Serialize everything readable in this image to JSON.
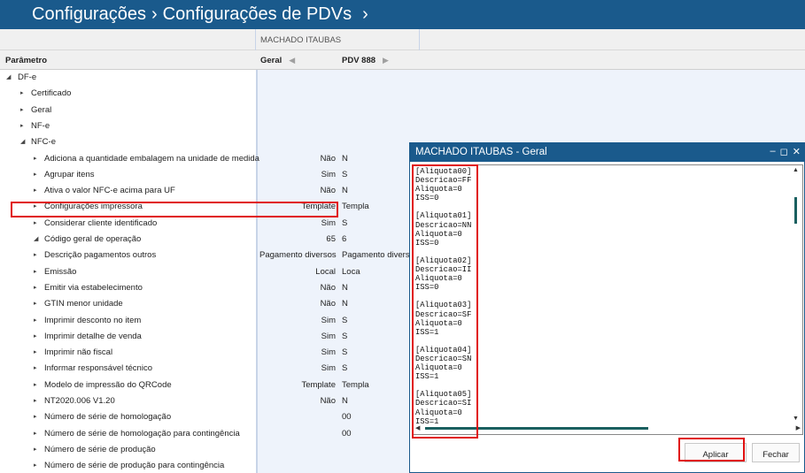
{
  "header": {
    "crumb1": "Configurações",
    "sep": "›",
    "crumb2": "Configurações de PDVs",
    "next": "›"
  },
  "grid": {
    "store": "MACHADO ITAUBAS",
    "col_param": "Parâmetro",
    "col_geral": "Geral",
    "col_pdv": "PDV 888",
    "rows": [
      {
        "label": "DF-e",
        "arrow": "◢",
        "level": 0,
        "v1": "",
        "v2": ""
      },
      {
        "label": "Certificado",
        "arrow": "▸",
        "level": 1,
        "v1": "",
        "v2": ""
      },
      {
        "label": "Geral",
        "arrow": "▸",
        "level": 1,
        "v1": "",
        "v2": ""
      },
      {
        "label": "NF-e",
        "arrow": "▸",
        "level": 1,
        "v1": "",
        "v2": ""
      },
      {
        "label": "NFC-e",
        "arrow": "◢",
        "level": 1,
        "v1": "",
        "v2": ""
      },
      {
        "label": "Adiciona a quantidade embalagem na unidade de medida",
        "arrow": "▸",
        "level": 2,
        "v1": "Não",
        "v2": "N"
      },
      {
        "label": "Agrupar itens",
        "arrow": "▸",
        "level": 2,
        "v1": "Sim",
        "v2": "S"
      },
      {
        "label": "Ativa o valor NFC-e acima para UF",
        "arrow": "▸",
        "level": 2,
        "v1": "Não",
        "v2": "N"
      },
      {
        "label": "Configurações impressora",
        "arrow": "▸",
        "level": 2,
        "v1": "Template",
        "v2": "Templa"
      },
      {
        "label": "Considerar cliente identificado",
        "arrow": "▸",
        "level": 2,
        "v1": "Sim",
        "v2": "S"
      },
      {
        "label": "Código geral de operação",
        "arrow": "◢",
        "level": 2,
        "v1": "65",
        "v2": "6"
      },
      {
        "label": "Descrição pagamentos outros",
        "arrow": "▸",
        "level": 2,
        "v1": "Pagamento diversos",
        "v2": "Pagamento divers"
      },
      {
        "label": "Emissão",
        "arrow": "▸",
        "level": 2,
        "v1": "Local",
        "v2": "Loca"
      },
      {
        "label": "Emitir via estabelecimento",
        "arrow": "▸",
        "level": 2,
        "v1": "Não",
        "v2": "N"
      },
      {
        "label": "GTIN menor unidade",
        "arrow": "▸",
        "level": 2,
        "v1": "Não",
        "v2": "N"
      },
      {
        "label": "Imprimir desconto no item",
        "arrow": "▸",
        "level": 2,
        "v1": "Sim",
        "v2": "S"
      },
      {
        "label": "Imprimir detalhe de venda",
        "arrow": "▸",
        "level": 2,
        "v1": "Sim",
        "v2": "S"
      },
      {
        "label": "Imprimir não fiscal",
        "arrow": "▸",
        "level": 2,
        "v1": "Sim",
        "v2": "S"
      },
      {
        "label": "Informar responsável técnico",
        "arrow": "▸",
        "level": 2,
        "v1": "Sim",
        "v2": "S"
      },
      {
        "label": "Modelo de impressão do QRCode",
        "arrow": "▸",
        "level": 2,
        "v1": "Template",
        "v2": "Templa"
      },
      {
        "label": "NT2020.006 V1.20",
        "arrow": "▸",
        "level": 2,
        "v1": "Não",
        "v2": "N"
      },
      {
        "label": "Número de série de homologação",
        "arrow": "▸",
        "level": 2,
        "v1": "",
        "v2": "00"
      },
      {
        "label": "Número de série de homologação para contingência",
        "arrow": "▸",
        "level": 2,
        "v1": "",
        "v2": "00"
      },
      {
        "label": "Número de série de produção",
        "arrow": "▸",
        "level": 2,
        "v1": "",
        "v2": ""
      },
      {
        "label": "Número de série de produção para contingência",
        "arrow": "▸",
        "level": 2,
        "v1": "",
        "v2": ""
      }
    ]
  },
  "dialog": {
    "title": "MACHADO ITAUBAS - Geral",
    "controls": [
      "–",
      "◻",
      "✕"
    ],
    "text": "[Aliquota00]\nDescricao=FF\nAliquota=0\nISS=0\n\n[Aliquota01]\nDescricao=NN\nAliquota=0\nISS=0\n\n[Aliquota02]\nDescricao=II\nAliquota=0\nISS=0\n\n[Aliquota03]\nDescricao=SF\nAliquota=0\nISS=1\n\n[Aliquota04]\nDescricao=SN\nAliquota=0\nISS=1\n\n[Aliquota05]\nDescricao=SI\nAliquota=0\nISS=1",
    "apply_label": "Aplicar",
    "close_label": "Fechar",
    "scroll_up": "▲",
    "scroll_down": "▼",
    "scroll_left": "◀",
    "scroll_right": "▶"
  },
  "colors": {
    "header_bg": "#1a5a8c",
    "highlight": "#e01010",
    "value_col_bg": "#eef3fb"
  }
}
